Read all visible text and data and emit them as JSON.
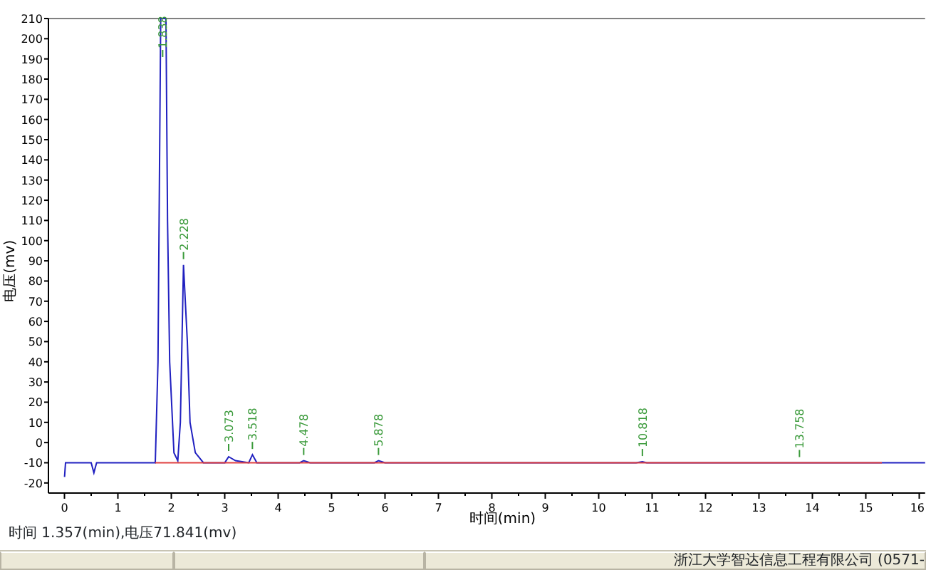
{
  "chromatogram": {
    "chart_data": {
      "type": "line",
      "xlabel": "时间(min)",
      "ylabel": "电压(mv)",
      "x": [
        0,
        0.02,
        0.5,
        0.55,
        0.6,
        1.7,
        1.75,
        1.8,
        1.9,
        1.93,
        1.97,
        2.05,
        2.12,
        2.17,
        2.228,
        2.3,
        2.35,
        2.45,
        2.6,
        3.0,
        3.073,
        3.2,
        3.45,
        3.518,
        3.6,
        4.4,
        4.478,
        4.6,
        5.8,
        5.878,
        6.0,
        10.7,
        10.818,
        10.9,
        15.3,
        16.11
      ],
      "series": [
        {
          "color": "#2020c0",
          "values": [
            -17,
            -10,
            -10,
            -15,
            -10,
            -10,
            40,
            210,
            210,
            110,
            40,
            -5,
            -9,
            10,
            88,
            50,
            10,
            -5,
            -10,
            -10,
            -7,
            -9,
            -10,
            -6,
            -10,
            -10,
            -9,
            -10,
            -10,
            -9,
            -10,
            -10,
            -9.5,
            -10,
            -10,
            -10
          ]
        },
        {
          "color": "#e04040",
          "values": [
            null,
            null,
            null,
            null,
            null,
            -10,
            -10,
            -10,
            -10,
            -10,
            -10,
            -10,
            -10,
            -10,
            -10,
            -10,
            -10,
            -10,
            -10,
            -10,
            -10,
            -10,
            -10,
            -10,
            -10,
            -10,
            -10,
            -10,
            -10,
            -10,
            -10,
            -10,
            -10,
            -10,
            -10,
            null
          ]
        }
      ],
      "xlim": [
        -0.3,
        16.11
      ],
      "ylim": [
        -25,
        210
      ],
      "xticks": [
        0,
        1,
        2,
        3,
        4,
        5,
        6,
        7,
        8,
        9,
        10,
        11,
        12,
        13,
        14,
        15,
        16
      ],
      "yticks": [
        -20,
        -10,
        0,
        10,
        20,
        30,
        40,
        50,
        60,
        70,
        80,
        90,
        100,
        110,
        120,
        130,
        140,
        150,
        160,
        170,
        180,
        190,
        200,
        210
      ],
      "annotations": [
        {
          "x": 1.838,
          "y": 210,
          "text": "1.838"
        },
        {
          "x": 2.228,
          "y": 88,
          "text": "2.228"
        },
        {
          "x": 3.073,
          "y": -7,
          "text": "3.073"
        },
        {
          "x": 3.518,
          "y": -6,
          "text": "3.518"
        },
        {
          "x": 4.478,
          "y": -9,
          "text": "4.478"
        },
        {
          "x": 5.878,
          "y": -9,
          "text": "5.878"
        },
        {
          "x": 10.818,
          "y": -9.5,
          "text": "10.818"
        },
        {
          "x": 13.758,
          "y": -10,
          "text": "13.758"
        }
      ]
    }
  },
  "cursor_readout": "时间 1.357(min),电压71.841(mv)",
  "status_bar": {
    "company": "浙江大学智达信息工程有限公司 (0571-"
  }
}
